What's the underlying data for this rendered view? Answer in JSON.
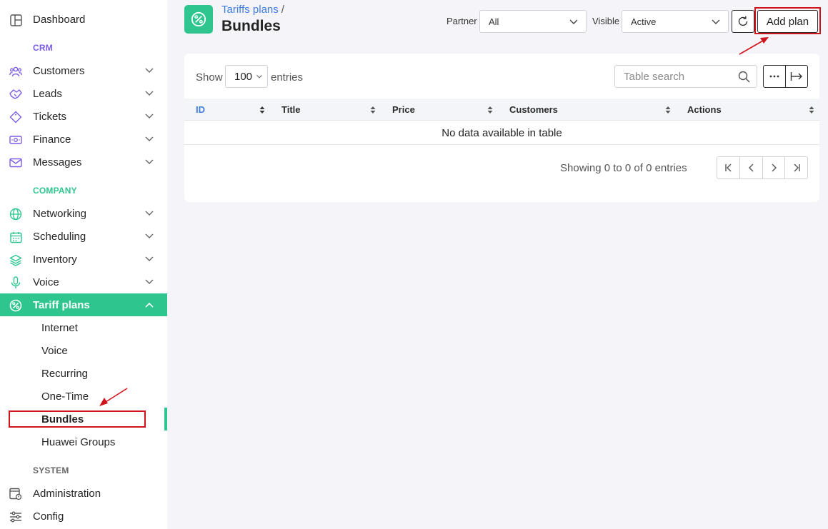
{
  "colors": {
    "accent": "#2ec68e",
    "crm_section": "#7b5be6",
    "company_section": "#2ec68e",
    "system_section": "#666666",
    "link": "#3e7ddc",
    "annotation": "#d0141b"
  },
  "sidebar": {
    "dashboard": {
      "label": "Dashboard",
      "icon": "dashboard-icon"
    },
    "crm_title": "CRM",
    "crm_items": [
      {
        "label": "Customers",
        "icon": "customers-icon"
      },
      {
        "label": "Leads",
        "icon": "leads-icon"
      },
      {
        "label": "Tickets",
        "icon": "tickets-icon"
      },
      {
        "label": "Finance",
        "icon": "finance-icon"
      },
      {
        "label": "Messages",
        "icon": "messages-icon"
      }
    ],
    "company_title": "COMPANY",
    "company_items": [
      {
        "label": "Networking",
        "icon": "networking-icon"
      },
      {
        "label": "Scheduling",
        "icon": "scheduling-icon"
      },
      {
        "label": "Inventory",
        "icon": "inventory-icon"
      },
      {
        "label": "Voice",
        "icon": "voice-icon"
      }
    ],
    "tariff": {
      "label": "Tariff plans",
      "icon": "tariff-icon"
    },
    "tariff_sub": [
      "Internet",
      "Voice",
      "Recurring",
      "One-Time",
      "Bundles",
      "Huawei Groups"
    ],
    "system_title": "SYSTEM",
    "system_items": [
      {
        "label": "Administration",
        "icon": "administration-icon"
      },
      {
        "label": "Config",
        "icon": "config-icon"
      }
    ]
  },
  "header": {
    "breadcrumb": "Tariffs plans",
    "breadcrumb_sep": "/",
    "title": "Bundles",
    "partner_label": "Partner",
    "partner_value": "All",
    "visible_label": "Visible",
    "visible_value": "Active",
    "add_plan": "Add plan"
  },
  "table": {
    "show_label": "Show",
    "page_length": "100",
    "entries_label": "entries",
    "search_placeholder": "Table search",
    "columns": [
      "ID",
      "Title",
      "Price",
      "Customers",
      "Actions"
    ],
    "empty_text": "No data available in table",
    "info": "Showing 0 to 0 of 0 entries"
  }
}
